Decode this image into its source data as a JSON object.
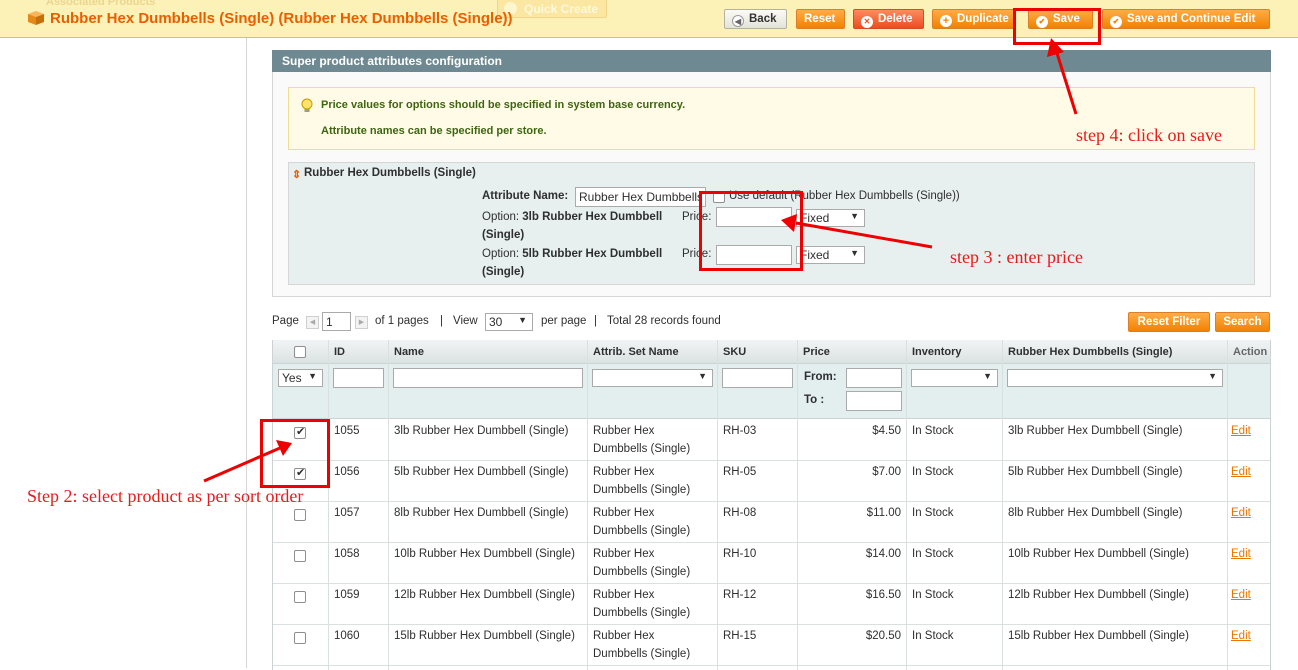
{
  "header": {
    "ghost_link": "Associated Products",
    "ghost_quick_create": "Quick Create",
    "title": "Rubber Hex Dumbbells (Single) (Rubber Hex Dumbbells (Single))",
    "buttons": {
      "back": "Back",
      "reset": "Reset",
      "delete": "Delete",
      "duplicate": "Duplicate",
      "save": "Save",
      "save_continue": "Save and Continue Edit"
    }
  },
  "config": {
    "heading": "Super product attributes configuration",
    "notices": [
      "Price values for options should be specified in system base currency.",
      "Attribute names can be specified per store."
    ],
    "attribute": {
      "title": "Rubber Hex Dumbbells (Single)",
      "name_label": "Attribute Name:",
      "name_value": "Rubber Hex Dumbbells",
      "use_default_label": "Use default (Rubber Hex Dumbbells (Single))",
      "options": [
        {
          "prefix": "Option:",
          "name_line1": "3lb Rubber Hex Dumbbell",
          "name_line2": "(Single)",
          "price_label": "Price:",
          "price_value": "",
          "type": "Fixed"
        },
        {
          "prefix": "Option:",
          "name_line1": "5lb Rubber Hex Dumbbell",
          "name_line2": "(Single)",
          "price_label": "Price:",
          "price_value": "",
          "type": "Fixed"
        }
      ]
    }
  },
  "pager": {
    "page_label": "Page",
    "page_value": "1",
    "of_pages": "of 1 pages",
    "sep": "|",
    "view_label": "View",
    "view_value": "30",
    "per_page": "per page",
    "total": "Total 28 records found",
    "reset_filter": "Reset Filter",
    "search": "Search"
  },
  "grid": {
    "headers": [
      "ID",
      "Name",
      "Attrib. Set Name",
      "SKU",
      "Price",
      "Inventory",
      "Rubber Hex Dumbbells (Single)",
      "Action"
    ],
    "filter": {
      "yes_value": "Yes",
      "price_from": "From:",
      "price_to": "To :"
    },
    "rows": [
      {
        "checked": true,
        "id": "1055",
        "name": "3lb Rubber Hex Dumbbell (Single)",
        "set1": "Rubber Hex",
        "set2": "Dumbbells (Single)",
        "sku": "RH-03",
        "price": "$4.50",
        "inventory": "In Stock",
        "attr": "3lb Rubber Hex Dumbbell (Single)",
        "action": "Edit"
      },
      {
        "checked": true,
        "id": "1056",
        "name": "5lb Rubber Hex Dumbbell (Single)",
        "set1": "Rubber Hex",
        "set2": "Dumbbells (Single)",
        "sku": "RH-05",
        "price": "$7.00",
        "inventory": "In Stock",
        "attr": "5lb Rubber Hex Dumbbell (Single)",
        "action": "Edit"
      },
      {
        "checked": false,
        "id": "1057",
        "name": "8lb Rubber Hex Dumbbell (Single)",
        "set1": "Rubber Hex",
        "set2": "Dumbbells (Single)",
        "sku": "RH-08",
        "price": "$11.00",
        "inventory": "In Stock",
        "attr": "8lb Rubber Hex Dumbbell (Single)",
        "action": "Edit"
      },
      {
        "checked": false,
        "id": "1058",
        "name": "10lb Rubber Hex Dumbbell (Single)",
        "set1": "Rubber Hex",
        "set2": "Dumbbells (Single)",
        "sku": "RH-10",
        "price": "$14.00",
        "inventory": "In Stock",
        "attr": "10lb Rubber Hex Dumbbell (Single)",
        "action": "Edit"
      },
      {
        "checked": false,
        "id": "1059",
        "name": "12lb Rubber Hex Dumbbell (Single)",
        "set1": "Rubber Hex",
        "set2": "Dumbbells (Single)",
        "sku": "RH-12",
        "price": "$16.50",
        "inventory": "In Stock",
        "attr": "12lb Rubber Hex Dumbbell (Single)",
        "action": "Edit"
      },
      {
        "checked": false,
        "id": "1060",
        "name": "15lb Rubber Hex Dumbbell (Single)",
        "set1": "Rubber Hex",
        "set2": "Dumbbells (Single)",
        "sku": "RH-15",
        "price": "$20.50",
        "inventory": "In Stock",
        "attr": "15lb Rubber Hex Dumbbell (Single)",
        "action": "Edit"
      }
    ]
  },
  "annotations": {
    "step2": "Step 2: select product as per sort order",
    "step3": "step 3 : enter price",
    "step4": "step 4: click on save",
    "color": "#e81a1a"
  }
}
